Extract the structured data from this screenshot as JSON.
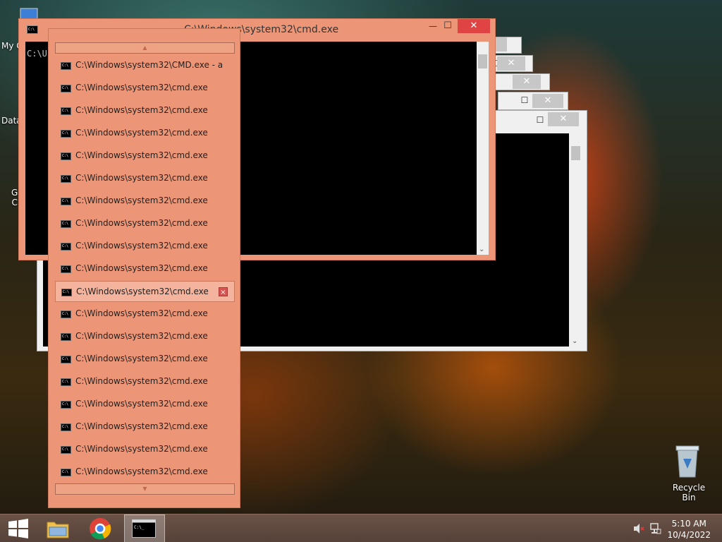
{
  "desktop": {
    "icons": [
      {
        "label": "My C"
      },
      {
        "label": "Data"
      },
      {
        "label": "G\nC"
      },
      {
        "label": "Recycle Bin"
      }
    ]
  },
  "main_window": {
    "title": "C:\\Windows\\system32\\cmd.exe",
    "console_text": "C:\\U",
    "close_symbol": "✕",
    "min_symbol": "—",
    "max_symbol": "☐"
  },
  "jump_list": {
    "scroll_up": "▲",
    "scroll_down": "▼",
    "items": [
      "C:\\Windows\\system32\\CMD.exe - a",
      "C:\\Windows\\system32\\cmd.exe",
      "C:\\Windows\\system32\\cmd.exe",
      "C:\\Windows\\system32\\cmd.exe",
      "C:\\Windows\\system32\\cmd.exe",
      "C:\\Windows\\system32\\cmd.exe",
      "C:\\Windows\\system32\\cmd.exe",
      "C:\\Windows\\system32\\cmd.exe",
      "C:\\Windows\\system32\\cmd.exe",
      "C:\\Windows\\system32\\cmd.exe",
      "C:\\Windows\\system32\\cmd.exe",
      "C:\\Windows\\system32\\cmd.exe",
      "C:\\Windows\\system32\\cmd.exe",
      "C:\\Windows\\system32\\cmd.exe",
      "C:\\Windows\\system32\\cmd.exe",
      "C:\\Windows\\system32\\cmd.exe",
      "C:\\Windows\\system32\\cmd.exe",
      "C:\\Windows\\system32\\cmd.exe",
      "C:\\Windows\\system32\\cmd.exe"
    ],
    "hot_index": 10,
    "close_symbol": "×"
  },
  "taskbar": {
    "clock_time": "5:10 AM",
    "clock_date": "10/4/2022"
  },
  "colors": {
    "window_accent": "#ec9677",
    "close_red": "#e04343"
  }
}
